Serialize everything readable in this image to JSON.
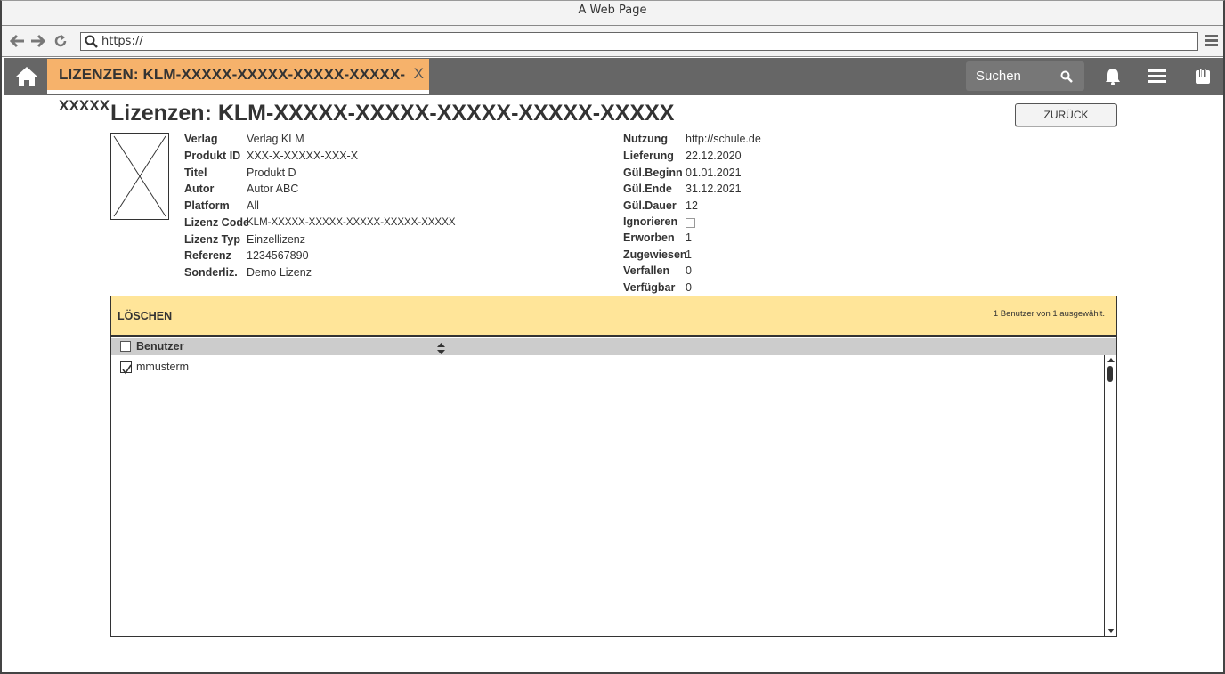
{
  "browser": {
    "window_title": "A Web Page",
    "url": "https://"
  },
  "appbar": {
    "tab_label": "LIZENZEN: KLM-XXXXX-XXXXX-XXXXX-XXXXX-XXXXX",
    "tab_close": "X",
    "search_label": "Suchen",
    "icons": [
      "home-icon",
      "search-icon",
      "bell-icon",
      "menu-icon",
      "logout-icon"
    ]
  },
  "page": {
    "title": "Lizenzen: KLM-XXXXX-XXXXX-XXXXX-XXXXX-XXXXX",
    "back_label": "ZURÜCK"
  },
  "details_left": [
    {
      "key": "Verlag",
      "value": "Verlag KLM"
    },
    {
      "key": "Produkt ID",
      "value": "XXX-X-XXXXX-XXX-X"
    },
    {
      "key": "Titel",
      "value": "Produkt D"
    },
    {
      "key": "Autor",
      "value": "Autor ABC"
    },
    {
      "key": "Platform",
      "value": "All"
    },
    {
      "key": "Lizenz Code",
      "value": "KLM-XXXXX-XXXXX-XXXXX-XXXXX-XXXXX"
    },
    {
      "key": "Lizenz Typ",
      "value": "Einzellizenz"
    },
    {
      "key": "Referenz",
      "value": "1234567890"
    },
    {
      "key": "Sonderliz.",
      "value": "Demo Lizenz"
    }
  ],
  "details_right": [
    {
      "key": "Nutzung",
      "value": "http://schule.de"
    },
    {
      "key": "Lieferung",
      "value": "22.12.2020"
    },
    {
      "key": "Gül.Beginn",
      "value": "01.01.2021"
    },
    {
      "key": "Gül.Ende",
      "value": "31.12.2021"
    },
    {
      "key": "Gül.Dauer",
      "value": "12"
    },
    {
      "key": "Ignorieren",
      "value": ""
    },
    {
      "key": "Erworben",
      "value": "1"
    },
    {
      "key": "Zugewiesen",
      "value": "1"
    },
    {
      "key": "Verfallen",
      "value": "0"
    },
    {
      "key": "Verfügbar",
      "value": "0"
    }
  ],
  "user_list": {
    "delete_label": "LÖSCHEN",
    "selection_status": "1 Benutzer von 1 ausgewählt.",
    "column_header": "Benutzer",
    "rows": [
      {
        "label": "mmusterm",
        "checked": true
      }
    ]
  }
}
